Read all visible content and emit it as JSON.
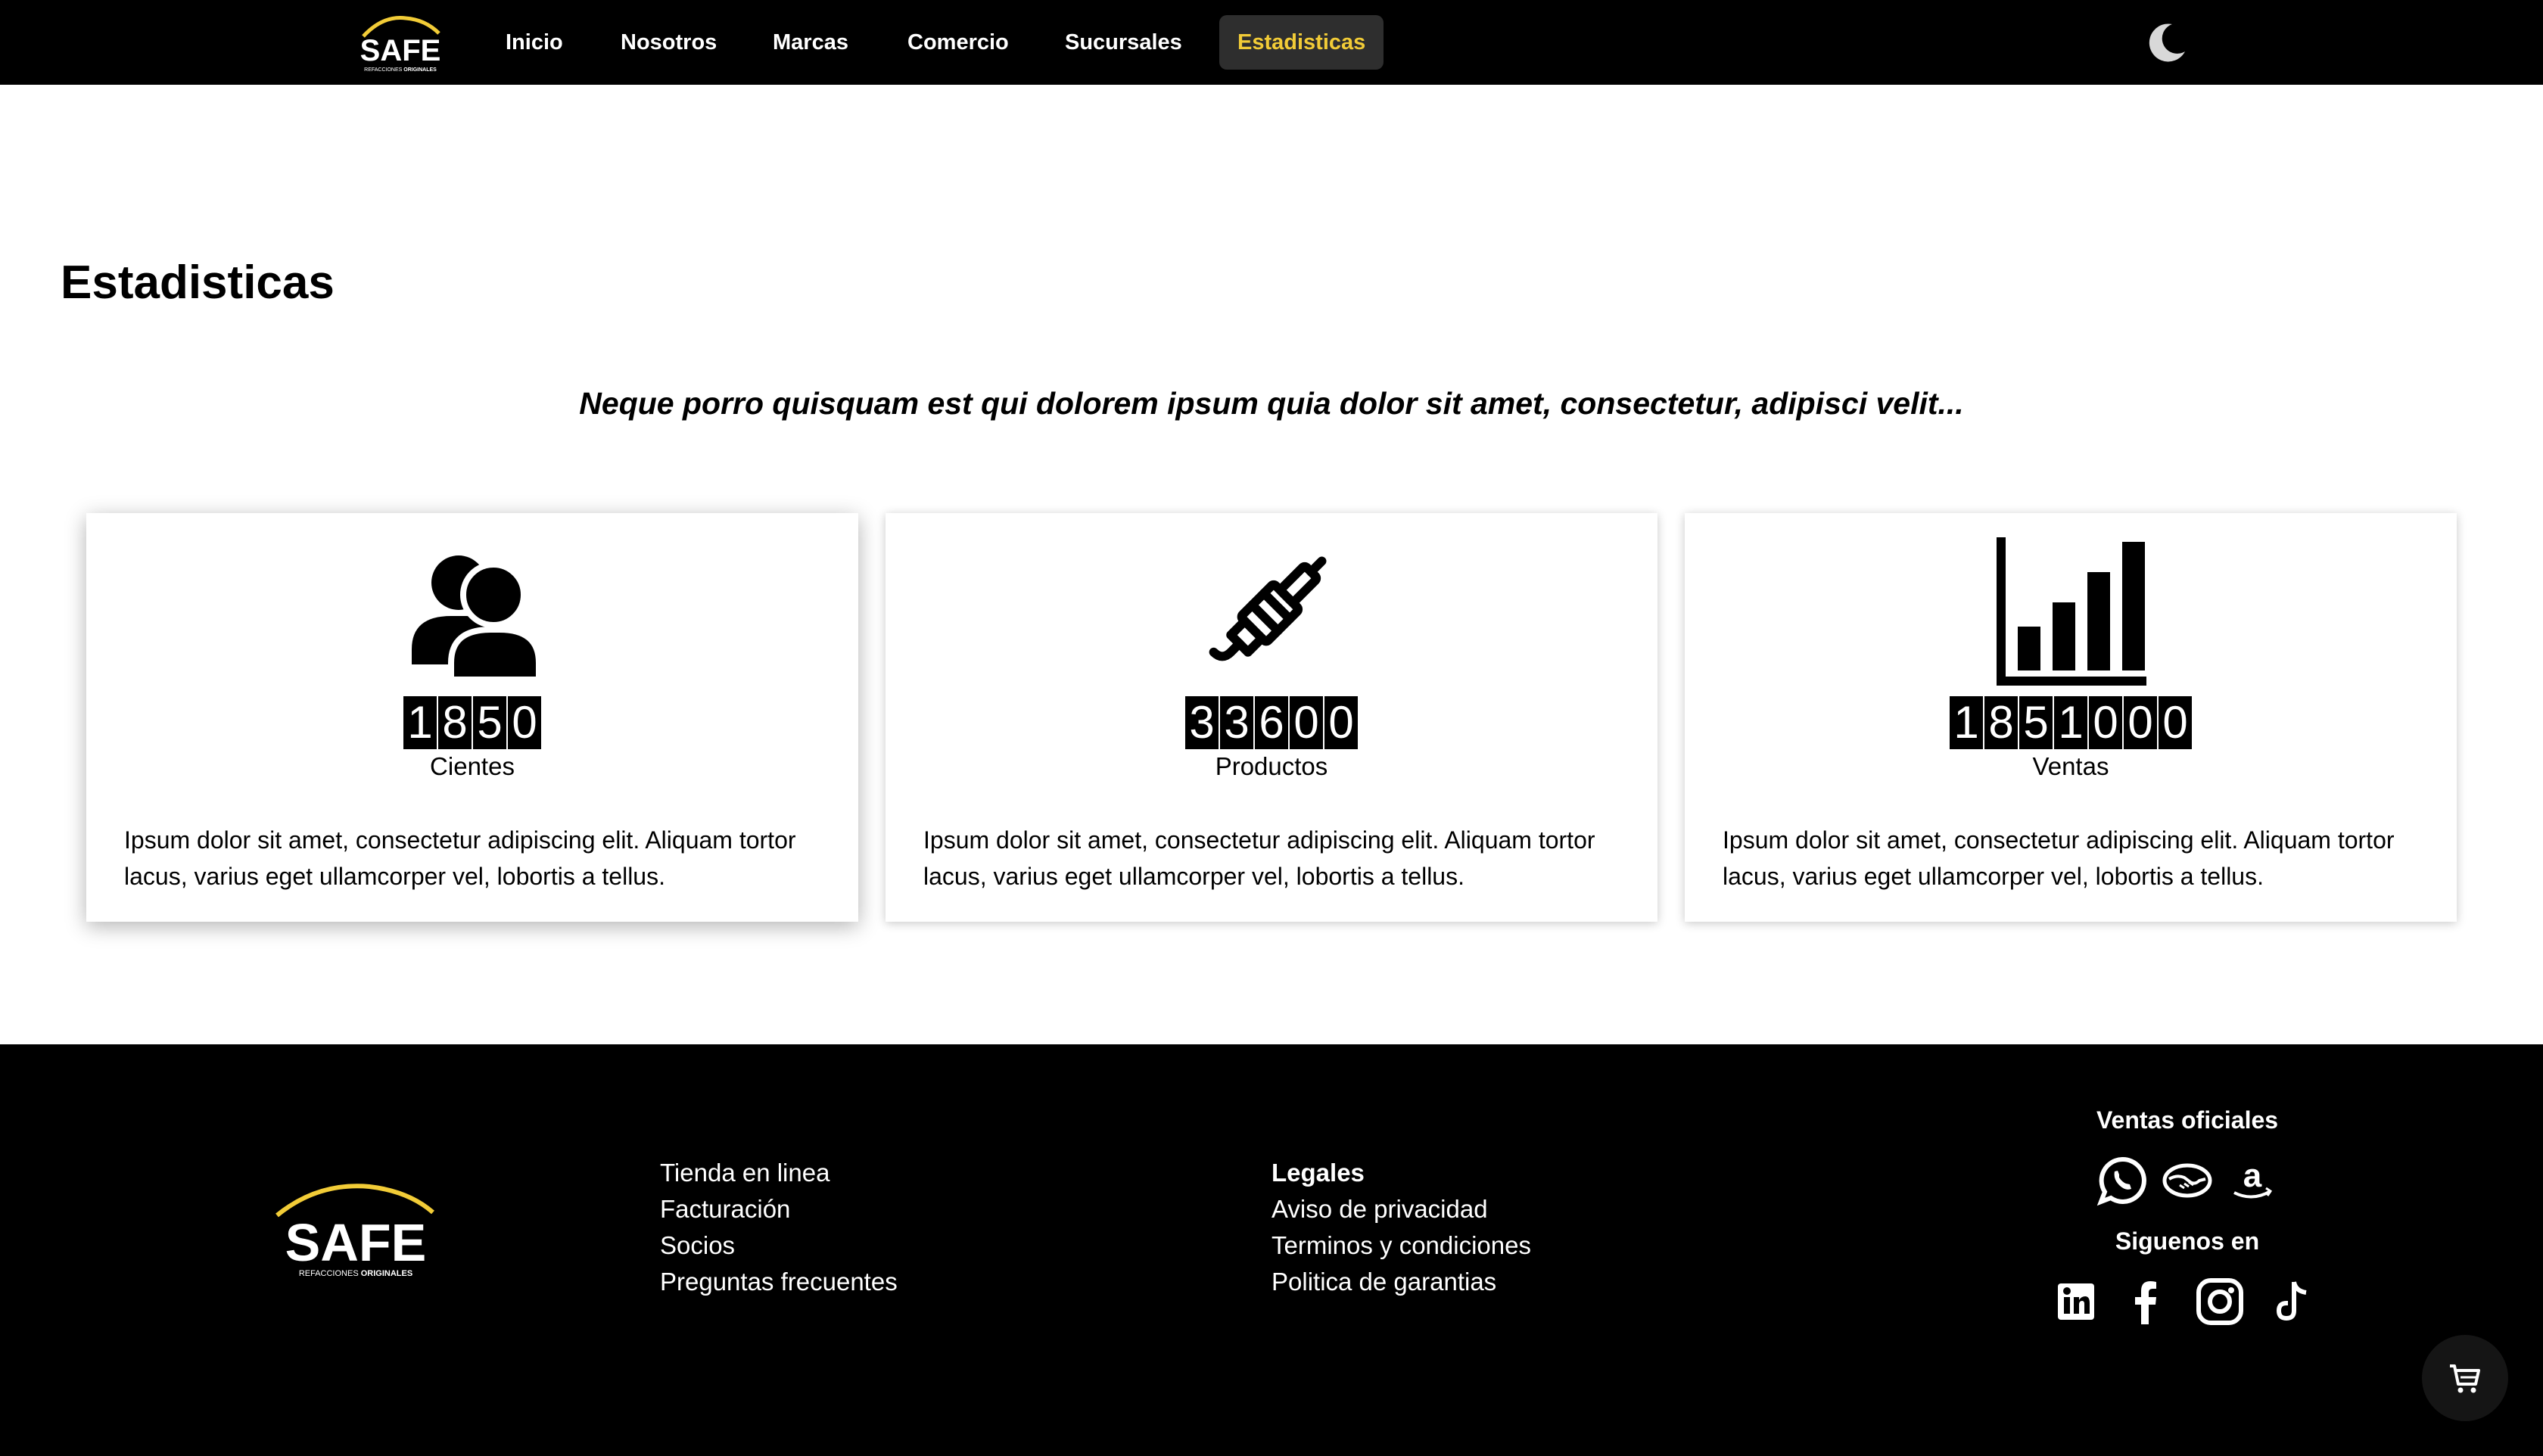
{
  "brand": {
    "name": "SAFE",
    "tagline_prefix": "REFACCIONES",
    "tagline_strong": "ORIGINALES"
  },
  "nav": {
    "items": [
      {
        "label": "Inicio"
      },
      {
        "label": "Nosotros"
      },
      {
        "label": "Marcas"
      },
      {
        "label": "Comercio"
      },
      {
        "label": "Sucursales"
      },
      {
        "label": "Estadisticas",
        "active": true
      }
    ],
    "active_color": "#f2cc37",
    "theme_toggle_icon": "moon-icon"
  },
  "main": {
    "title": "Estadisticas",
    "subtitle": "Neque porro quisquam est qui dolorem ipsum quia dolor sit amet, consectetur, adipisci velit...",
    "cards": [
      {
        "icon": "users-icon",
        "value": "1850",
        "label": "Cientes",
        "description": "Ipsum dolor sit amet, consectetur adipiscing elit. Aliquam tortor lacus, varius eget ullamcorper vel, lobortis a tellus."
      },
      {
        "icon": "spark-plug-icon",
        "value": "33600",
        "label": "Productos",
        "description": "Ipsum dolor sit amet, consectetur adipiscing elit. Aliquam tortor lacus, varius eget ullamcorper vel, lobortis a tellus."
      },
      {
        "icon": "bar-chart-icon",
        "value": "1851000",
        "label": "Ventas",
        "description": "Ipsum dolor sit amet, consectetur adipiscing elit. Aliquam tortor lacus, varius eget ullamcorper vel, lobortis a tellus."
      }
    ]
  },
  "footer": {
    "links": [
      "Tienda en linea",
      "Facturación",
      "Socios",
      "Preguntas frecuentes"
    ],
    "legal": {
      "heading": "Legales",
      "links": [
        "Aviso de privacidad",
        "Terminos y condiciones",
        "Politica de garantias"
      ]
    },
    "sales": {
      "title": "Ventas oficiales",
      "icons": [
        "whatsapp-icon",
        "mercado-libre-icon",
        "amazon-icon"
      ]
    },
    "social": {
      "title": "Siguenos en",
      "icons": [
        "linkedin-icon",
        "facebook-icon",
        "instagram-icon",
        "tiktok-icon"
      ]
    }
  },
  "cart_icon": "shopping-cart-icon"
}
